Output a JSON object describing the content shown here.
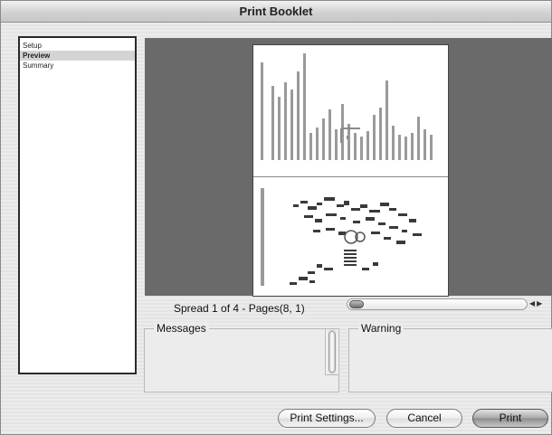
{
  "window": {
    "title": "Print Booklet"
  },
  "sidebar": {
    "items": [
      {
        "label": "Setup",
        "selected": false
      },
      {
        "label": "Preview",
        "selected": true
      },
      {
        "label": "Summary",
        "selected": false
      }
    ]
  },
  "preview": {
    "spread_label": "Spread 1 of 4 - Pages(8, 1)",
    "spread_position": 0.0
  },
  "panels": {
    "messages_title": "Messages",
    "warning_title": "Warning"
  },
  "buttons": {
    "print_settings": "Print Settings...",
    "cancel": "Cancel",
    "print": "Print"
  },
  "colors": {
    "preview_background": "#6a6a6a",
    "selected_item": "#d4d4d4"
  },
  "icons": {
    "scroll_left": "triangle-left",
    "scroll_right": "triangle-right"
  }
}
